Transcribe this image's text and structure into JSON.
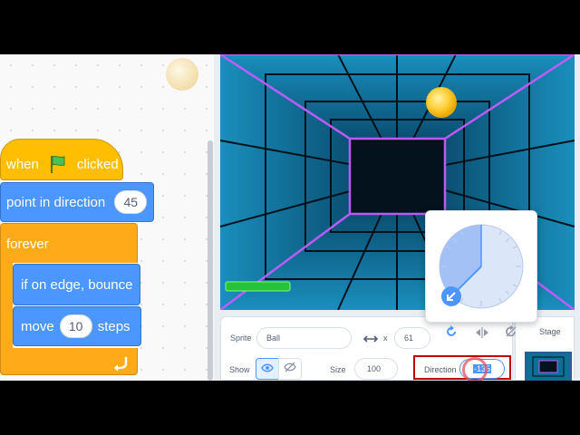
{
  "blocks": {
    "when_clicked": {
      "when": "when",
      "clicked": "clicked"
    },
    "point_in_direction": {
      "label": "point in direction",
      "value": "45"
    },
    "forever": {
      "label": "forever"
    },
    "if_on_edge_bounce": {
      "label": "if on edge, bounce"
    },
    "move": {
      "label": "move",
      "value": "10",
      "unit": "steps"
    }
  },
  "sprite_info": {
    "sprite_label": "Sprite",
    "sprite_name": "Ball",
    "x_label": "x",
    "x_value": "61",
    "show_label": "Show",
    "size_label": "Size",
    "size_value": "100",
    "direction_label": "Direction",
    "direction_value": "-135"
  },
  "stage_pane": {
    "label": "Stage"
  },
  "icons": {
    "flag": "green-flag-icon",
    "loop_arrow": "loop-arrow-icon",
    "show_visible": "eye-icon",
    "show_hidden": "eye-slash-icon",
    "xy_arrows": "horizontal-arrows-icon",
    "rotate_all": "rotate-all-around-icon",
    "left_right": "left-right-flip-icon",
    "no_rotate": "dont-rotate-icon"
  },
  "colors": {
    "events": "#ffbf00",
    "motion": "#4c97ff",
    "control": "#ffab19",
    "stage_tile": "#0c6f96",
    "neon": "#c45cff",
    "highlight": "#c00000"
  }
}
